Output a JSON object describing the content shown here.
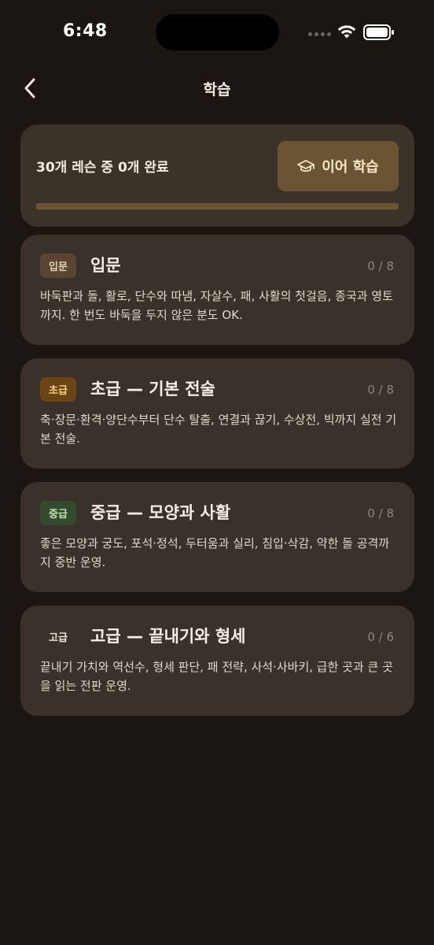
{
  "status_bar": {
    "time": "6:48"
  },
  "nav": {
    "title": "학습",
    "back_icon": "chevron-left-icon"
  },
  "progress": {
    "text": "30개 레슨 중 0개 완료",
    "continue_label": "이어 학습",
    "continue_icon": "graduation-cap-icon",
    "completed": 0,
    "total": 30,
    "fraction": 0.0
  },
  "levels": [
    {
      "badge": "입문",
      "badge_bg": "#5a4532",
      "badge_color": "#e8d2b2",
      "title": "입문",
      "count": "0 / 8",
      "description": "바둑판과 돌, 활로, 단수와 따냄, 자살수, 패, 사활의 첫걸음, 종국과 영토까지. 한 번도 바둑을 두지 않은 분도 OK."
    },
    {
      "badge": "초급",
      "badge_bg": "#6b4515",
      "badge_color": "#f3d08a",
      "title": "초급 — 기본 전술",
      "count": "0 / 8",
      "description": "축·장문·환격·양단수부터 단수 탈출, 연결과 끊기, 수상전, 빅까지 실전 기본 전술."
    },
    {
      "badge": "중급",
      "badge_bg": "#344a2f",
      "badge_color": "#bfe3b0",
      "title": "중급 — 모양과 사활",
      "count": "0 / 8",
      "description": "좋은 모양과 궁도, 포석·정석, 두터움과 실리, 침입·삭감, 약한 돌 공격까지 중반 운영."
    },
    {
      "badge": "고급",
      "badge_bg": "#3a312a",
      "badge_color": "#f0e6da",
      "title": "고급 — 끝내기와 형세",
      "count": "0 / 6",
      "description": "끝내기 가치와 역선수, 형세 판단, 패 전략, 사석·사바키, 급한 곳과 큰 곳을 읽는 전판 운영."
    }
  ]
}
